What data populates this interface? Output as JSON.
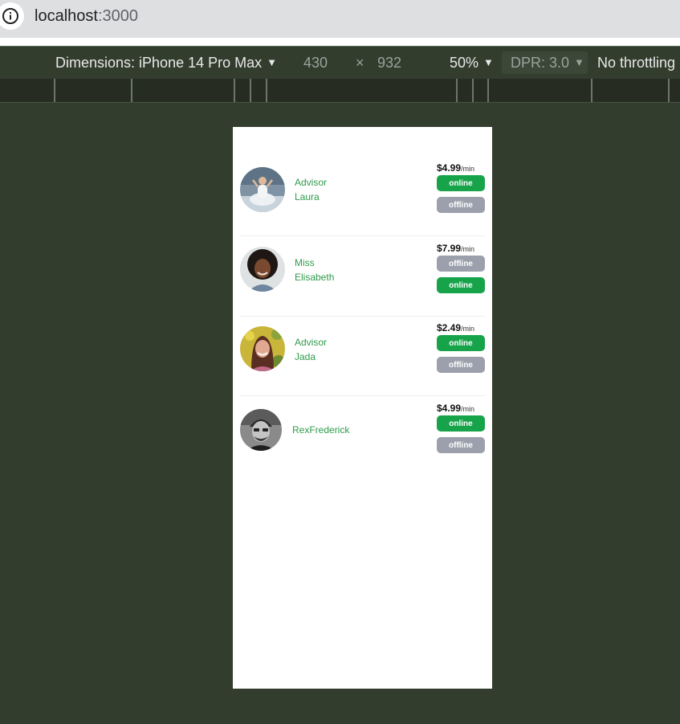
{
  "browser": {
    "url_host": "localhost",
    "url_port": ":3000"
  },
  "devtools": {
    "dimensions_label": "Dimensions: iPhone 14 Pro Max",
    "width": "430",
    "times": "×",
    "height": "932",
    "zoom": "50%",
    "dpr": "DPR: 3.0",
    "throttling": "No throttling"
  },
  "advisors": [
    {
      "title": "Advisor",
      "name": "Laura",
      "price": "$4.99",
      "unit": "/min",
      "buttons": [
        "online",
        "offline"
      ]
    },
    {
      "title": "Miss",
      "name": "Elisabeth",
      "price": "$7.99",
      "unit": "/min",
      "buttons": [
        "offline",
        "online"
      ]
    },
    {
      "title": "Advisor",
      "name": "Jada",
      "price": "$2.49",
      "unit": "/min",
      "buttons": [
        "online",
        "offline"
      ]
    },
    {
      "title": "",
      "name": "RexFrederick",
      "price": "$4.99",
      "unit": "/min",
      "buttons": [
        "online",
        "offline"
      ]
    }
  ],
  "colors": {
    "online": "#17a34a",
    "offline": "#9ca0ad",
    "name_text": "#2e9b4a"
  }
}
